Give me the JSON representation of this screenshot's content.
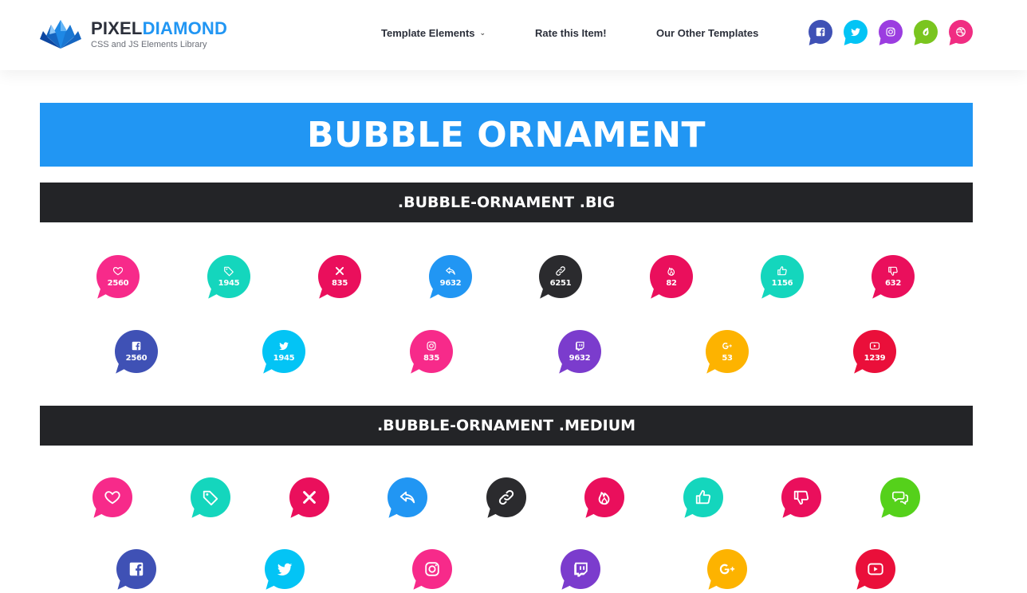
{
  "header": {
    "logo_part1": "PIXEL",
    "logo_part2": "DIAMOND",
    "logo_sub": "CSS and JS Elements Library",
    "nav": [
      "Template Elements",
      "Rate this Item!",
      "Our Other Templates"
    ],
    "social": [
      {
        "icon": "facebook-icon",
        "color": "#3f51b5"
      },
      {
        "icon": "twitter-icon",
        "color": "#03c4f5"
      },
      {
        "icon": "instagram-icon",
        "color": "#9b3de0"
      },
      {
        "icon": "envato-icon",
        "color": "#7ac51f"
      },
      {
        "icon": "dribbble-icon",
        "color": "#f02d82"
      }
    ]
  },
  "banner_title": "BUBBLE ORNAMENT",
  "sections": [
    {
      "title": ".BUBBLE-ORNAMENT .BIG"
    },
    {
      "title": ".BUBBLE-ORNAMENT .MEDIUM"
    }
  ],
  "big_row1": [
    {
      "icon": "heart-icon",
      "count": "2560",
      "color": "#f72a8a"
    },
    {
      "icon": "tag-icon",
      "count": "1945",
      "color": "#14d6bd"
    },
    {
      "icon": "close-icon",
      "count": "835",
      "color": "#ea0f5c"
    },
    {
      "icon": "reply-icon",
      "count": "9632",
      "color": "#2196f3"
    },
    {
      "icon": "link-icon",
      "count": "6251",
      "color": "#2b2b2e"
    },
    {
      "icon": "fire-icon",
      "count": "82",
      "color": "#ea0f5c"
    },
    {
      "icon": "thumbs-up-icon",
      "count": "1156",
      "color": "#14d6bd"
    },
    {
      "icon": "thumbs-down-icon",
      "count": "632",
      "color": "#ea0f5c"
    }
  ],
  "big_row2": [
    {
      "icon": "facebook-icon",
      "count": "2560",
      "color": "#3f51b5"
    },
    {
      "icon": "twitter-icon",
      "count": "1945",
      "color": "#03c4f5"
    },
    {
      "icon": "instagram-icon",
      "count": "835",
      "color": "#f72a8a"
    },
    {
      "icon": "twitch-icon",
      "count": "9632",
      "color": "#7b3ccd"
    },
    {
      "icon": "google-plus-icon",
      "count": "53",
      "color": "#fdb300"
    },
    {
      "icon": "youtube-icon",
      "count": "1239",
      "color": "#ea0f3a"
    }
  ],
  "med_row1": [
    {
      "icon": "heart-icon",
      "color": "#f72a8a"
    },
    {
      "icon": "tag-icon",
      "color": "#14d6bd"
    },
    {
      "icon": "close-icon",
      "color": "#ea0f5c"
    },
    {
      "icon": "reply-icon",
      "color": "#2196f3"
    },
    {
      "icon": "link-icon",
      "color": "#2b2b2e"
    },
    {
      "icon": "fire-icon",
      "color": "#ea0f5c"
    },
    {
      "icon": "thumbs-up-icon",
      "color": "#14d6bd"
    },
    {
      "icon": "thumbs-down-icon",
      "color": "#ea0f5c"
    },
    {
      "icon": "comments-icon",
      "color": "#55d11b"
    }
  ],
  "med_row2": [
    {
      "icon": "facebook-icon",
      "color": "#3f51b5"
    },
    {
      "icon": "twitter-icon",
      "color": "#03c4f5"
    },
    {
      "icon": "instagram-icon",
      "color": "#f72a8a"
    },
    {
      "icon": "twitch-icon",
      "color": "#7b3ccd"
    },
    {
      "icon": "google-plus-icon",
      "color": "#fdb300"
    },
    {
      "icon": "youtube-icon",
      "color": "#ea0f3a"
    }
  ]
}
